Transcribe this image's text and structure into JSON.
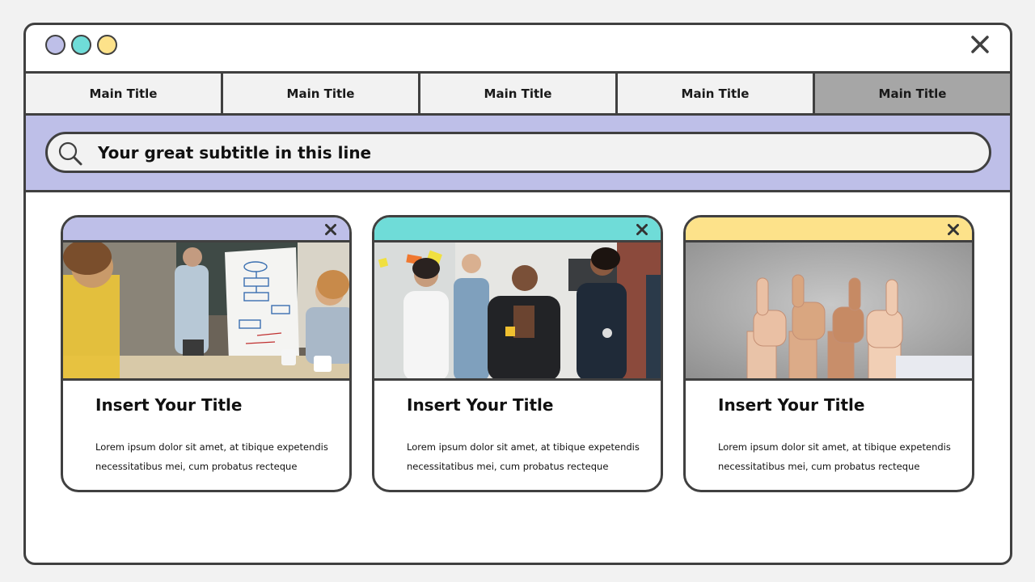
{
  "window": {
    "dots": [
      {
        "name": "lavender",
        "color": "#bebfe8"
      },
      {
        "name": "teal",
        "color": "#6fdcd8"
      },
      {
        "name": "yellow",
        "color": "#fde28a"
      }
    ]
  },
  "tabs": [
    {
      "label": "Main Title"
    },
    {
      "label": "Main Title"
    },
    {
      "label": "Main Title"
    },
    {
      "label": "Main Title"
    },
    {
      "label": "Main Title",
      "active": true
    }
  ],
  "search": {
    "text": "Your great subtitle in this line"
  },
  "cards": [
    {
      "accent": "#bebfe8",
      "image": "meeting-whiteboard-photo",
      "title": "Insert Your Title",
      "body": "Lorem  ipsum dolor sit amet, at tibique expetendis necessitatibus mei, cum probatus recteque"
    },
    {
      "accent": "#6fdcd8",
      "image": "team-sticky-notes-photo",
      "title": "Insert Your Title",
      "body": "Lorem  ipsum dolor sit amet, at tibique expetendis necessitatibus mei, cum probatus recteque"
    },
    {
      "accent": "#fde28a",
      "image": "thumbs-up-hands-photo",
      "title": "Insert Your Title",
      "body": "Lorem  ipsum dolor sit amet, at tibique expetendis necessitatibus mei, cum probatus recteque"
    }
  ],
  "colors": {
    "outline": "#404040",
    "band": "#bebfe8",
    "active_tab": "#a6a6a6",
    "tab_bg": "#f2f2f2"
  }
}
